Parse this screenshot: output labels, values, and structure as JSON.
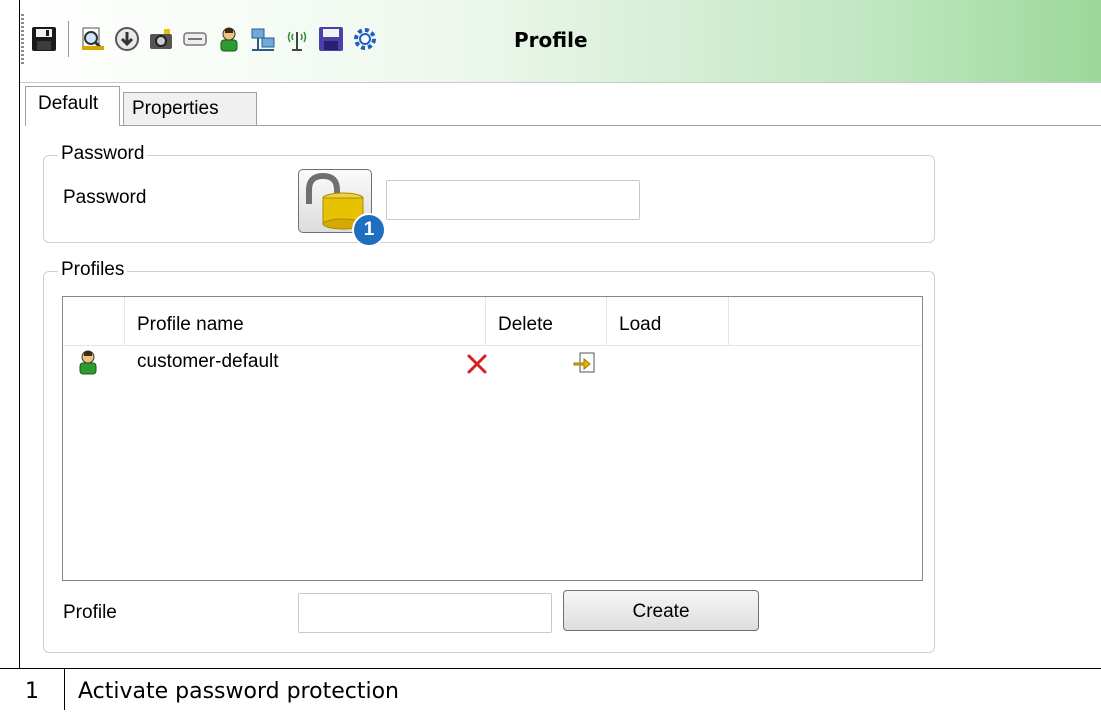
{
  "toolbar": {
    "title": "Profile",
    "icons": [
      "save-icon",
      "print-preview-icon",
      "download-icon",
      "camera-icon",
      "card-reader-icon",
      "user-icon",
      "network-icon",
      "antenna-icon",
      "floppy-icon",
      "settings-gear-icon"
    ]
  },
  "tabs": [
    {
      "label": "Default",
      "active": true
    },
    {
      "label": "Properties",
      "active": false
    }
  ],
  "password_group": {
    "title": "Password",
    "label": "Password",
    "value": "",
    "badge": "1"
  },
  "profiles_group": {
    "title": "Profiles",
    "columns": [
      "Profile name",
      "Delete",
      "Load"
    ],
    "rows": [
      {
        "name": "customer-default",
        "icon": "user-icon",
        "delete_icon": "delete-x-icon",
        "load_icon": "load-arrow-icon"
      }
    ],
    "profile_label": "Profile",
    "profile_value": "",
    "create_label": "Create"
  },
  "legend": {
    "number": "1",
    "text": "Activate password protection"
  },
  "colors": {
    "toolbar_gradient_end": "#9bd89b",
    "badge": "#1e6fc0",
    "delete_red": "#d42020"
  }
}
